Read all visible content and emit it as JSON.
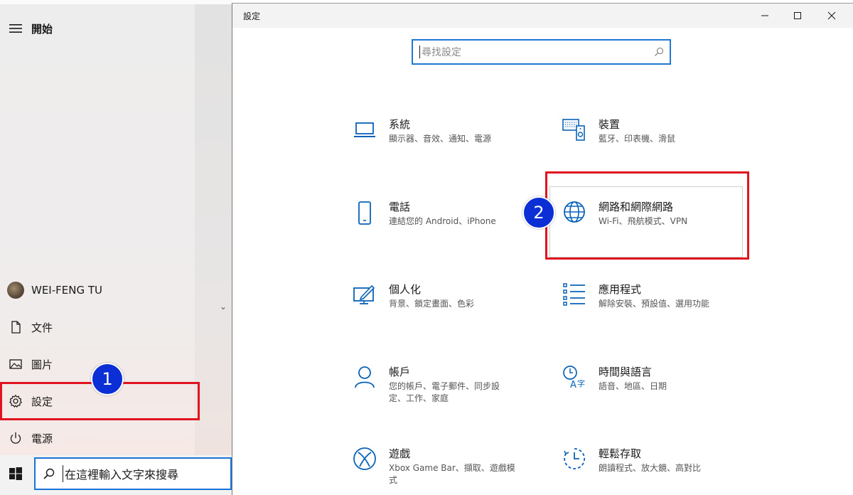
{
  "start_menu": {
    "title": "開始",
    "user": "WEI-FENG TU",
    "items": [
      {
        "label": "文件"
      },
      {
        "label": "圖片"
      },
      {
        "label": "設定"
      },
      {
        "label": "電源"
      }
    ],
    "step1": "1"
  },
  "taskbar": {
    "search_placeholder": "在這裡輸入文字來搜尋"
  },
  "settings": {
    "window_title": "設定",
    "search_placeholder": "尋找設定",
    "step2": "2",
    "categories": [
      {
        "title": "系統",
        "subtitle": "顯示器、音效、通知、電源",
        "icon": "laptop-icon"
      },
      {
        "title": "裝置",
        "subtitle": "藍牙、印表機、滑鼠",
        "icon": "devices-icon"
      },
      {
        "title": "電話",
        "subtitle": "連結您的 Android、iPhone",
        "icon": "phone-icon"
      },
      {
        "title": "網路和網際網路",
        "subtitle": "Wi-Fi、飛航模式、VPN",
        "icon": "globe-icon"
      },
      {
        "title": "個人化",
        "subtitle": "背景、鎖定畫面、色彩",
        "icon": "personalization-icon"
      },
      {
        "title": "應用程式",
        "subtitle": "解除安裝、預設值、選用功能",
        "icon": "apps-list-icon"
      },
      {
        "title": "帳戶",
        "subtitle": "您的帳戶、電子郵件、同步設定、工作、家庭",
        "icon": "person-icon"
      },
      {
        "title": "時間與語言",
        "subtitle": "語音、地區、日期",
        "icon": "time-language-icon"
      },
      {
        "title": "遊戲",
        "subtitle": "Xbox Game Bar、擷取、遊戲模式",
        "icon": "xbox-icon"
      },
      {
        "title": "輕鬆存取",
        "subtitle": "朗讀程式、放大鏡、高對比",
        "icon": "ease-of-access-icon"
      }
    ]
  },
  "colors": {
    "accent": "#0078d7",
    "highlight": "#e0141f",
    "badge": "#0b2fd4"
  }
}
